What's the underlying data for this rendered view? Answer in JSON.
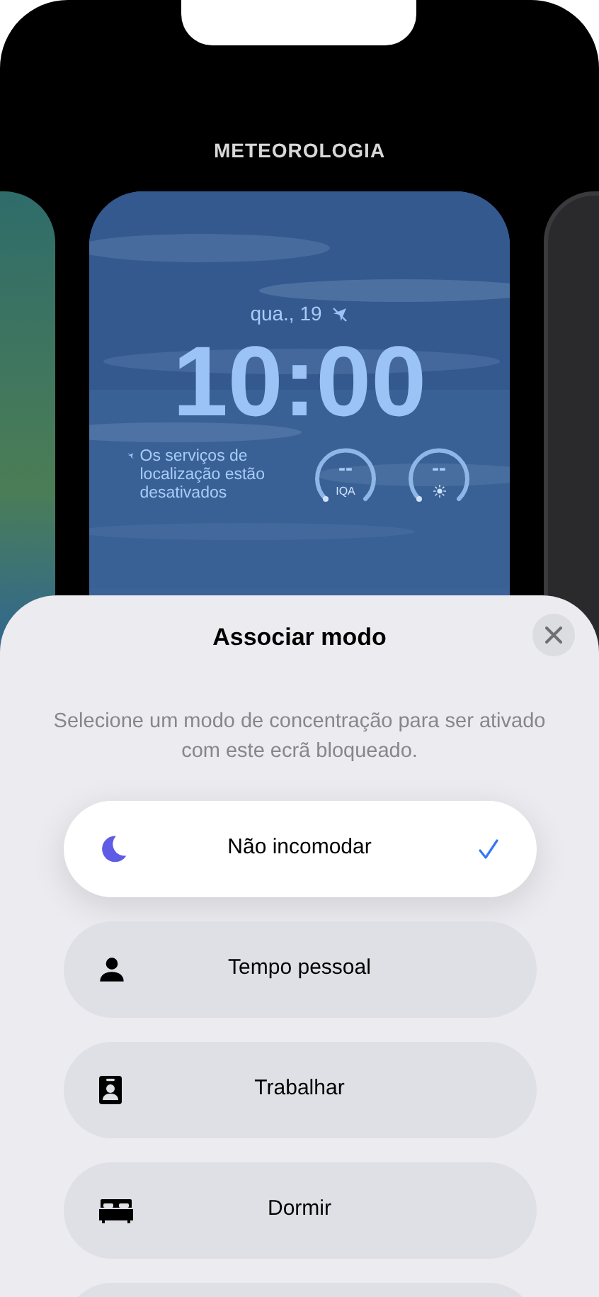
{
  "header": {
    "title": "METEOROLOGIA"
  },
  "lock_screen": {
    "date": "qua., 19",
    "time": "10:00",
    "location_notice": "Os serviços de localização estão desativados",
    "widgets": [
      {
        "kind": "aqi",
        "value": "--",
        "label": "IQA"
      },
      {
        "kind": "uv",
        "value": "--"
      }
    ]
  },
  "sheet": {
    "title": "Associar modo",
    "description": "Selecione um modo de concentração para ser ativado com este ecrã bloqueado.",
    "modes": [
      {
        "kind": "moon",
        "label": "Não incomodar",
        "selected": true
      },
      {
        "kind": "person",
        "label": "Tempo pessoal",
        "selected": false
      },
      {
        "kind": "badge",
        "label": "Trabalhar",
        "selected": false
      },
      {
        "kind": "bed",
        "label": "Dormir",
        "selected": false
      }
    ]
  }
}
